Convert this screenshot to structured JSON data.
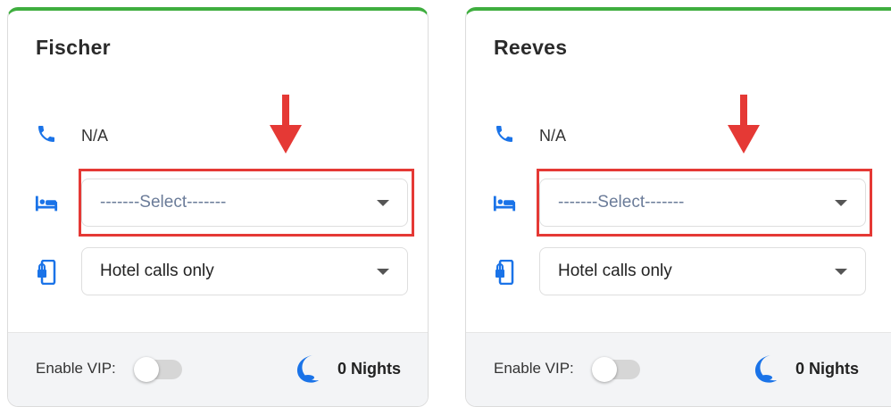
{
  "colors": {
    "accent_green": "#3fae3f",
    "icon_blue": "#1a73e8",
    "highlight_red": "#e53935"
  },
  "cards": [
    {
      "guest_name": "Fischer",
      "phone": "N/A",
      "room_select": "-------Select-------",
      "call_option": "Hotel calls only",
      "vip_label": "Enable VIP:",
      "vip_enabled": false,
      "nights": "0 Nights"
    },
    {
      "guest_name": "Reeves",
      "phone": "N/A",
      "room_select": "-------Select-------",
      "call_option": "Hotel calls only",
      "vip_label": "Enable VIP:",
      "vip_enabled": false,
      "nights": "0 Nights"
    }
  ],
  "icons": {
    "phone": "phone-icon",
    "bed": "bed-icon",
    "lock_phone": "phone-lock-icon",
    "moon": "moon-icon",
    "caret": "chevron-down-icon",
    "annotation": "red-arrow-annotation"
  }
}
